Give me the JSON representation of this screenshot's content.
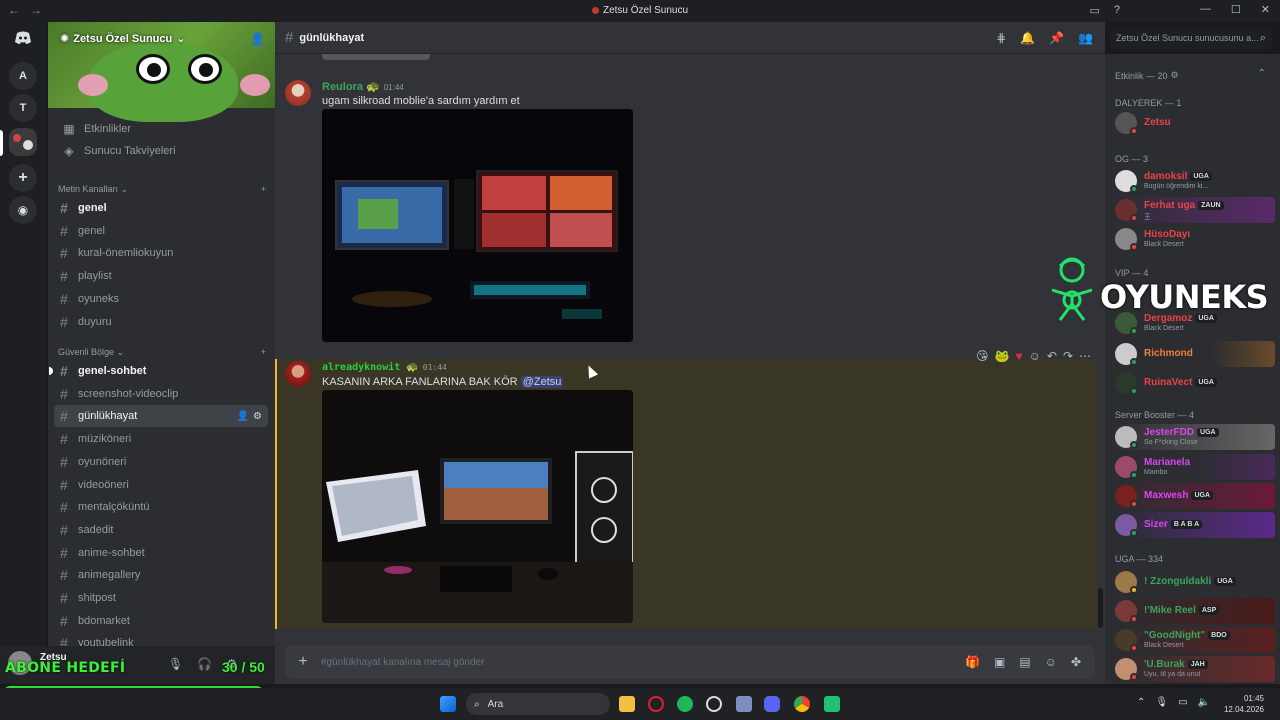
{
  "window": {
    "title": "Zetsu Özel Sunucu",
    "back": "←",
    "forward": "→",
    "ctrl_min": "—",
    "ctrl_max": "☐",
    "ctrl_close": "✕"
  },
  "servers": {
    "items": [
      "A",
      "T"
    ]
  },
  "server": {
    "name": "Zetsu Özel Sunucu"
  },
  "sidebar": {
    "shortcuts": [
      {
        "label": "Etkinlikler",
        "icon": "calendar-icon"
      },
      {
        "label": "Sunucu Takviyeleri",
        "icon": "boost-icon"
      }
    ],
    "categories": [
      {
        "label": "Metin Kanalları"
      },
      {
        "label": "Güvenli Bölge"
      }
    ],
    "channels_a": [
      "genel",
      "genel",
      "kural-önemliokuyun",
      "playlist",
      "oyuneks",
      "duyuru"
    ],
    "channels_b": [
      "genel-sohbet",
      "screenshot-videoclip",
      "günlükhayat",
      "müziköneri",
      "oyunöneri",
      "videoöneri",
      "mentalçöküntü",
      "sadedit",
      "anime-sohbet",
      "animegallery",
      "shitpost",
      "bdomarket",
      "youtubelink"
    ]
  },
  "user": {
    "name": "Zetsu"
  },
  "overlay": {
    "goal_label": "ABONE HEDEFİ",
    "goal_count": "30 / 50",
    "goal_fraction": 0.6
  },
  "chat": {
    "channel": "günlükhayat",
    "messages": [
      {
        "author": "Reulora",
        "time": "01:44",
        "text": "ugam silkroad moblie'a sardım yardım et"
      },
      {
        "author": "alreadyknowit",
        "time": "01:44",
        "text": "KASANIN ARKA FANLARINA BAK KÖR",
        "mention": "@Zetsu"
      }
    ],
    "composer_placeholder": "#günlükhayat kanalına mesaj gönder"
  },
  "search": {
    "placeholder": "Zetsu Özel Sunucu sunucusunu a..."
  },
  "members": {
    "groups": [
      {
        "label": "Etkinlik — 20"
      },
      {
        "label": "DALYEREK — 1"
      },
      {
        "label": "OG — 3"
      },
      {
        "label": "VIP — 4"
      },
      {
        "label": "Server Booster — 4"
      },
      {
        "label": "UGA — 334"
      }
    ],
    "list": [
      {
        "name": "Zetsu",
        "status": "",
        "tag": ""
      },
      {
        "name": "damoksil",
        "status": "Bugün öğrendim ki...",
        "tag": "UGA"
      },
      {
        "name": "Ferhat uga",
        "status": "王",
        "tag": "ZAUN"
      },
      {
        "name": "HüsoDayı",
        "status": "Black Desert",
        "tag": ""
      },
      {
        "name": "Dergamoz",
        "status": "Black Desert",
        "tag": "UGA"
      },
      {
        "name": "Richmond",
        "status": "",
        "tag": ""
      },
      {
        "name": "RuinaVect",
        "status": "",
        "tag": "UGA"
      },
      {
        "name": "JesterFDD",
        "status": "So F*cking Close",
        "tag": "UGA"
      },
      {
        "name": "Marianela",
        "status": "Mambo",
        "tag": ""
      },
      {
        "name": "Maxwesh",
        "status": "",
        "tag": "UGA"
      },
      {
        "name": "Sizer",
        "status": "",
        "tag": "B A B A"
      },
      {
        "name": "! Zzonguldakli",
        "status": "",
        "tag": "UGA"
      },
      {
        "name": "!'Mike Reel",
        "status": "",
        "tag": "ASP"
      },
      {
        "name": "\"GoodNight\"",
        "status": "Black Desert",
        "tag": "BDO"
      },
      {
        "name": "'U.Burak",
        "status": "Uyu, öl ya da unut",
        "tag": "JAH"
      }
    ]
  },
  "watermark": {
    "text": "OYUNEKS"
  },
  "taskbar": {
    "search": "Ara",
    "time": "01:45",
    "date": "12.04.2026"
  },
  "colors": {
    "accent": "#5865f2",
    "online": "#23a55a",
    "mention_bg": "#3c4270"
  }
}
